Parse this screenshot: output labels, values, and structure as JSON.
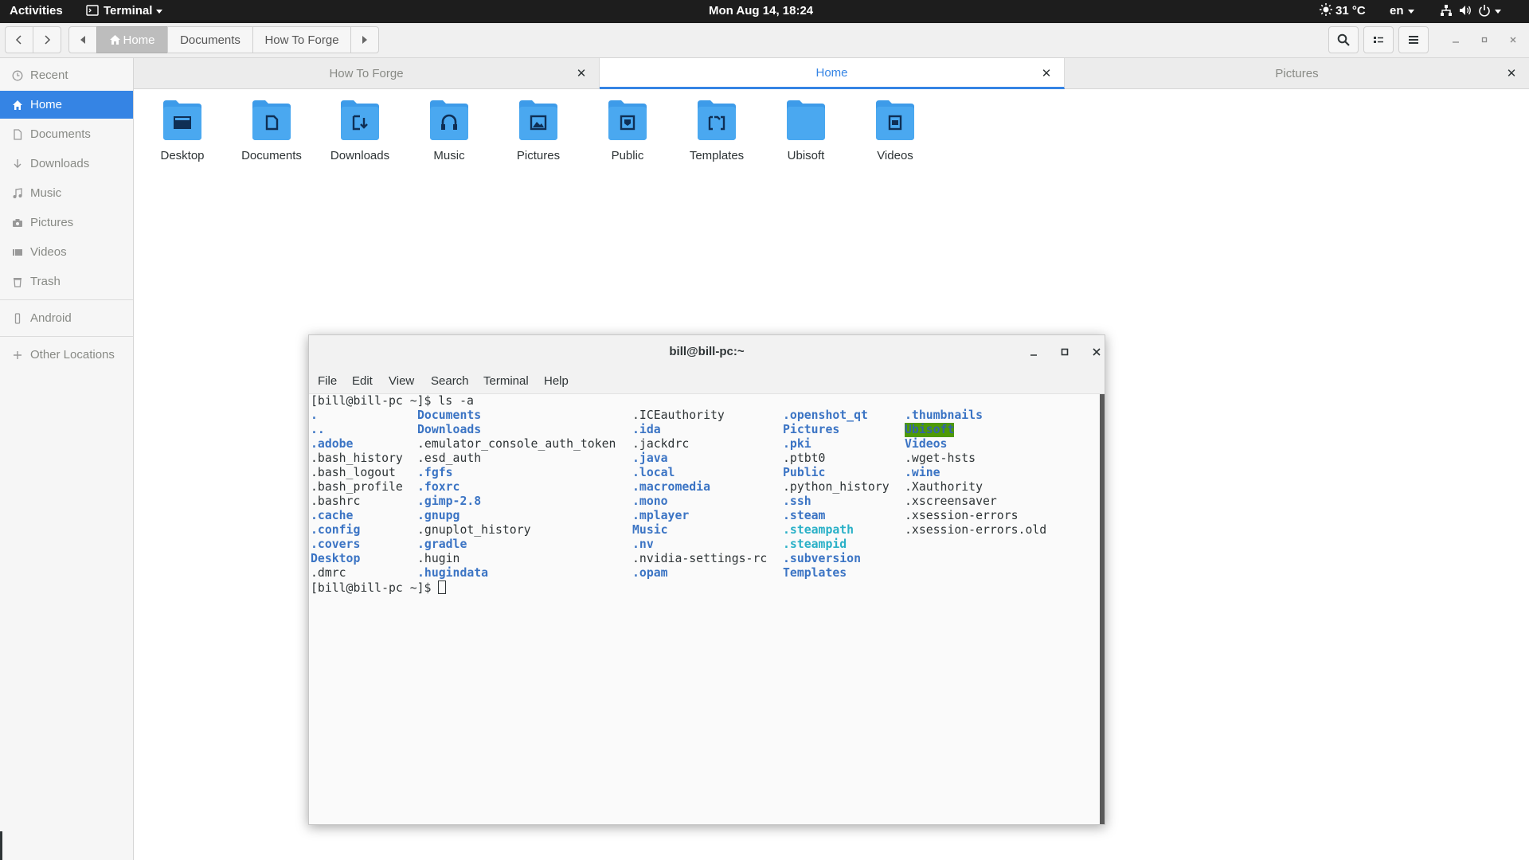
{
  "topbar": {
    "activities": "Activities",
    "app_menu": "Terminal",
    "clock": "Mon Aug 14, 18:24",
    "weather": "31 °C",
    "language": "en"
  },
  "headerbar": {
    "breadcrumbs": [
      "Home",
      "Documents",
      "How To Forge"
    ]
  },
  "sidebar": {
    "items": [
      {
        "label": "Recent",
        "icon": "clock-icon"
      },
      {
        "label": "Home",
        "icon": "home-icon",
        "active": true
      },
      {
        "label": "Documents",
        "icon": "document-icon"
      },
      {
        "label": "Downloads",
        "icon": "download-icon"
      },
      {
        "label": "Music",
        "icon": "music-icon"
      },
      {
        "label": "Pictures",
        "icon": "camera-icon"
      },
      {
        "label": "Videos",
        "icon": "video-icon"
      },
      {
        "label": "Trash",
        "icon": "trash-icon"
      },
      {
        "label": "Android",
        "icon": "phone-icon"
      },
      {
        "label": "Other Locations",
        "icon": "plus-icon"
      }
    ]
  },
  "tabs": [
    {
      "label": "How To Forge"
    },
    {
      "label": "Home",
      "active": true
    },
    {
      "label": "Pictures"
    }
  ],
  "folders": [
    {
      "label": "Desktop",
      "icon": "desktop-folder-icon"
    },
    {
      "label": "Documents",
      "icon": "documents-folder-icon"
    },
    {
      "label": "Downloads",
      "icon": "downloads-folder-icon"
    },
    {
      "label": "Music",
      "icon": "music-folder-icon"
    },
    {
      "label": "Pictures",
      "icon": "pictures-folder-icon"
    },
    {
      "label": "Public",
      "icon": "public-folder-icon"
    },
    {
      "label": "Templates",
      "icon": "templates-folder-icon"
    },
    {
      "label": "Ubisoft",
      "icon": "folder-icon"
    },
    {
      "label": "Videos",
      "icon": "videos-folder-icon"
    }
  ],
  "terminal": {
    "title": "bill@bill-pc:~",
    "menu": [
      "File",
      "Edit",
      "View",
      "Search",
      "Terminal",
      "Help"
    ],
    "prompt": "[bill@bill-pc ~]$ ",
    "command": "ls -a",
    "columns": [
      [
        ".",
        "..",
        ".adobe",
        ".bash_history",
        ".bash_logout",
        ".bash_profile",
        ".bashrc",
        ".cache",
        ".config",
        ".covers",
        "Desktop",
        ".dmrc"
      ],
      [
        "Documents",
        "Downloads",
        ".emulator_console_auth_token",
        ".esd_auth",
        ".fgfs",
        ".foxrc",
        ".gimp-2.8",
        ".gnupg",
        ".gnuplot_history",
        ".gradle",
        ".hugin",
        ".hugindata"
      ],
      [
        ".ICEauthority",
        ".ida",
        ".jackdrc",
        ".java",
        ".local",
        ".macromedia",
        ".mono",
        ".mplayer",
        "Music",
        ".nv",
        ".nvidia-settings-rc",
        ".opam"
      ],
      [
        ".openshot_qt",
        "Pictures",
        ".pki",
        ".ptbt0",
        "Public",
        ".python_history",
        ".ssh",
        ".steam",
        ".steampath",
        ".steampid",
        ".subversion",
        "Templates"
      ],
      [
        ".thumbnails",
        "Ubisoft",
        "Videos",
        ".wget-hsts",
        ".wine",
        ".Xauthority",
        ".xscreensaver",
        ".xsession-errors",
        ".xsession-errors.old"
      ]
    ],
    "styles": [
      [
        "dir",
        "dir",
        "dir",
        "",
        "",
        "",
        "",
        "dir",
        "dir",
        "dir",
        "dir",
        ""
      ],
      [
        "dir",
        "dir",
        "",
        "",
        "dir",
        "dir",
        "dir",
        "dir",
        "",
        "dir",
        "",
        "dir"
      ],
      [
        "",
        "dir",
        "",
        "dir",
        "dir",
        "dir",
        "dir",
        "dir",
        "dir",
        "dir",
        "",
        "dir"
      ],
      [
        "dir",
        "dir",
        "dir",
        "",
        "dir",
        "",
        "dir",
        "dir",
        "cyan",
        "cyan",
        "dir",
        "dir"
      ],
      [
        "dir",
        "hl",
        "dir",
        "",
        "dir",
        "",
        "",
        "",
        ""
      ]
    ]
  },
  "colors": {
    "accent": "#3584e4",
    "folder_blue": "#3d9be9",
    "terminal_dir": "#3b74c4",
    "terminal_symlink": "#29b0c7",
    "terminal_highlight_bg": "#4e9a06"
  }
}
